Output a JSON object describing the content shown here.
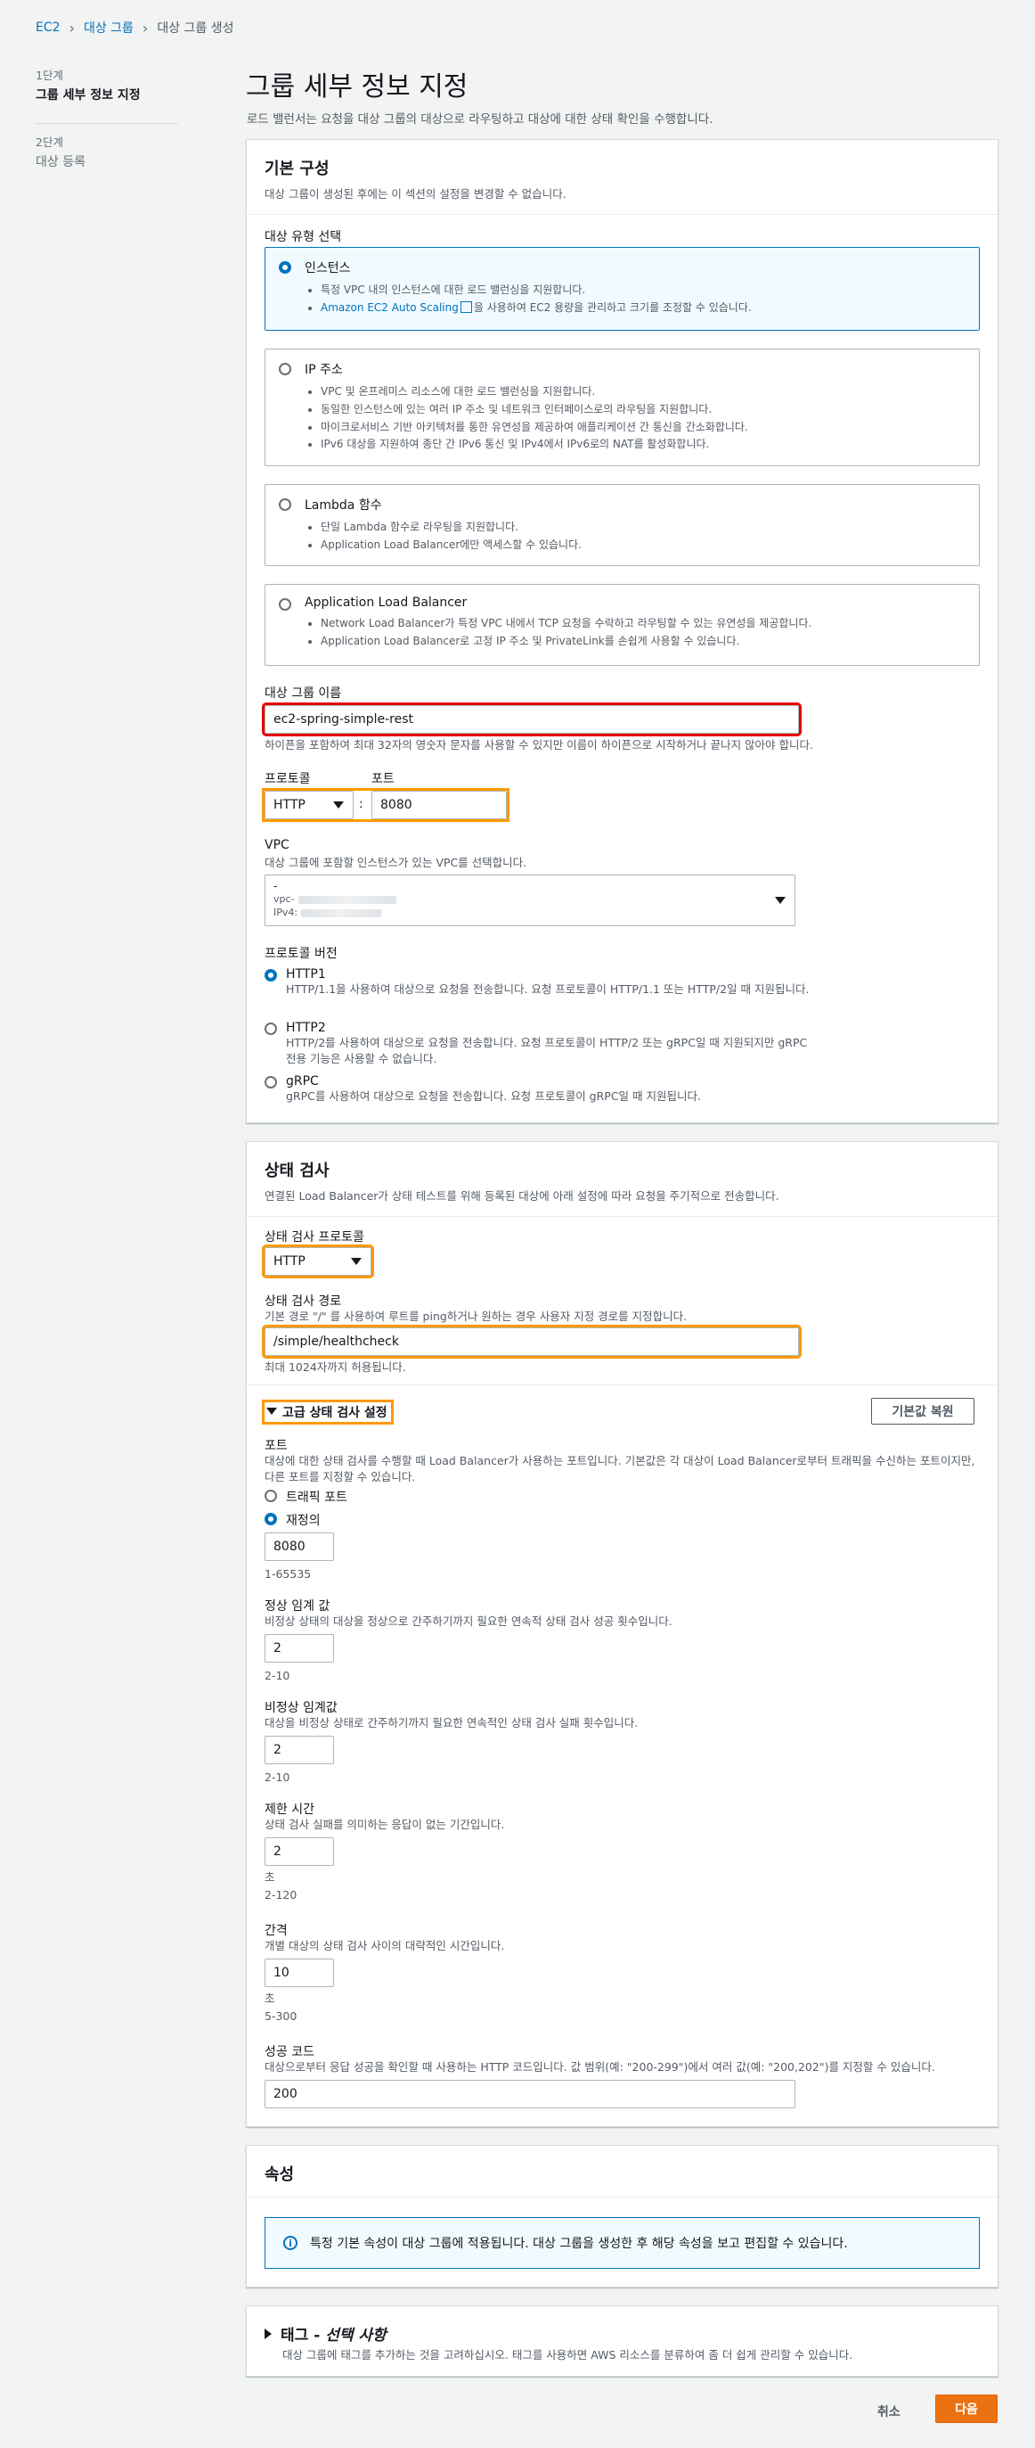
{
  "breadcrumb": {
    "items": [
      "EC2",
      "대상 그룹",
      "대상 그룹 생성"
    ]
  },
  "steps": [
    {
      "number": "1단계",
      "name": "그룹 세부 정보 지정"
    },
    {
      "number": "2단계",
      "name": "대상 등록"
    }
  ],
  "page": {
    "title": "그룹 세부 정보 지정",
    "subtitle": "로드 밸런서는 요청을 대상 그룹의 대상으로 라우팅하고 대상에 대한 상태 확인을 수행합니다."
  },
  "basic": {
    "title": "기본 구성",
    "desc": "대상 그룹이 생성된 후에는 이 섹션의 설정을 변경할 수 없습니다.",
    "target_type_label": "대상 유형 선택",
    "types": [
      {
        "title": "인스턴스",
        "bullets": [
          "특정 VPC 내의 인스턴스에 대한 로드 밸런싱을 지원합니다."
        ],
        "link": "Amazon EC2 Auto Scaling",
        "link_rest": "을 사용하여 EC2 용량을 관리하고 크기를 조정할 수 있습니다."
      },
      {
        "title": "IP 주소",
        "bullets": [
          "VPC 및 온프레미스 리소스에 대한 로드 밸런싱을 지원합니다.",
          "동일한 인스턴스에 있는 여러 IP 주소 및 네트워크 인터페이스로의 라우팅을 지원합니다.",
          "마이크로서비스 기반 아키텍처를 통한 유연성을 제공하여 애플리케이션 간 통신을 간소화합니다.",
          "IPv6 대상을 지원하여 종단 간 IPv6 통신 및 IPv4에서 IPv6로의 NAT를 활성화합니다."
        ]
      },
      {
        "title": "Lambda 함수",
        "bullets": [
          "단일 Lambda 함수로 라우팅을 지원합니다.",
          "Application Load Balancer에만 액세스할 수 있습니다."
        ]
      },
      {
        "title": "Application Load Balancer",
        "bullets": [
          "Network Load Balancer가 특정 VPC 내에서 TCP 요청을 수락하고 라우팅할 수 있는 유연성을 제공합니다.",
          "Application Load Balancer로 고정 IP 주소 및 PrivateLink를 손쉽게 사용할 수 있습니다."
        ]
      }
    ],
    "name_label": "대상 그룹 이름",
    "name_value": "ec2-spring-simple-rest",
    "name_hint": "하이픈을 포함하여 최대 32자의 영숫자 문자를 사용할 수 있지만 이름이 하이픈으로 시작하거나 끝나지 않아야 합니다.",
    "protocol_label": "프로토콜",
    "port_label": "포트",
    "protocol_value": "HTTP",
    "port_sep": ":",
    "port_value": "8080",
    "vpc_label": "VPC",
    "vpc_desc": "대상 그룹에 포함할 인스턴스가 있는 VPC를 선택합니다.",
    "vpc_dash": "-",
    "vpc_id_prefix": "vpc-",
    "vpc_ipv4_prefix": "IPv4:",
    "pv_label": "프로토콜 버전",
    "pv_options": [
      {
        "title": "HTTP1",
        "desc": "HTTP/1.1을 사용하여 대상으로 요청을 전송합니다. 요청 프로토콜이 HTTP/1.1 또는 HTTP/2일 때 지원됩니다."
      },
      {
        "title": "HTTP2",
        "desc": "HTTP/2를 사용하여 대상으로 요청을 전송합니다. 요청 프로토콜이 HTTP/2 또는 gRPC일 때 지원되지만 gRPC 전용 기능은 사용할 수 없습니다."
      },
      {
        "title": "gRPC",
        "desc": "gRPC를 사용하여 대상으로 요청을 전송합니다. 요청 프로토콜이 gRPC일 때 지원됩니다."
      }
    ]
  },
  "health": {
    "title": "상태 검사",
    "desc": "연결된 Load Balancer가 상태 테스트를 위해 등록된 대상에 아래 설정에 따라 요청을 주기적으로 전송합니다.",
    "protocol_label": "상태 검사 프로토콜",
    "protocol_value": "HTTP",
    "path_label": "상태 검사 경로",
    "path_desc": "기본 경로 \"/\" 를 사용하여 루트를 ping하거나 원하는 경우 사용자 지정 경로를 지정합니다.",
    "path_value": "/simple/healthcheck",
    "path_hint": "최대 1024자까지 허용됩니다.",
    "advanced_label": "고급 상태 검사 설정",
    "restore_button": "기본값 복원",
    "port_label": "포트",
    "port_desc": "대상에 대한 상태 검사를 수행할 때 Load Balancer가 사용하는 포트입니다. 기본값은 각 대상이 Load Balancer로부터 트래픽을 수신하는 포트이지만, 다른 포트를 지정할 수 있습니다.",
    "port_opt_traffic": "트래픽 포트",
    "port_opt_override": "재정의",
    "port_value": "8080",
    "port_range": "1-65535",
    "healthy_label": "정상 임계 값",
    "healthy_desc": "비정상 상태의 대상을 정상으로 간주하기까지 필요한 연속적 상태 검사 성공 횟수입니다.",
    "healthy_value": "2",
    "healthy_range": "2-10",
    "unhealthy_label": "비정상 임계값",
    "unhealthy_desc": "대상을 비정상 상태로 간주하기까지 필요한 연속적인 상태 검사 실패 횟수입니다.",
    "unhealthy_value": "2",
    "unhealthy_range": "2-10",
    "timeout_label": "제한 시간",
    "timeout_desc": "상태 검사 실패를 의미하는 응답이 없는 기간입니다.",
    "timeout_value": "2",
    "timeout_unit": "초",
    "timeout_range": "2-120",
    "interval_label": "간격",
    "interval_desc": "개별 대상의 상태 검사 사이의 대략적인 시간입니다.",
    "interval_value": "10",
    "interval_unit": "초",
    "interval_range": "5-300",
    "success_label": "성공 코드",
    "success_desc": "대상으로부터 응답 성공을 확인할 때 사용하는 HTTP 코드입니다. 값 범위(예: \"200-299\")에서 여러 값(예: \"200,202\")를 지정할 수 있습니다.",
    "success_value": "200"
  },
  "attributes": {
    "title": "속성",
    "info": "특정 기본 속성이 대상 그룹에 적용됩니다. 대상 그룹을 생성한 후 해당 속성을 보고 편집할 수 있습니다.",
    "info_icon": "i"
  },
  "tags": {
    "title_prefix": "태그 - ",
    "title_italic": "선택 사항",
    "desc": "대상 그룹에 태그를 추가하는 것을 고려하십시오. 태그를 사용하면 AWS 리소스를 분류하여 좀 더 쉽게 관리할 수 있습니다."
  },
  "footer": {
    "cancel": "취소",
    "next": "다음"
  },
  "colors": {
    "primary": "#ec7211",
    "link": "#0073bb",
    "highlight_red": "#e60000",
    "highlight_orange": "#ff9900"
  }
}
